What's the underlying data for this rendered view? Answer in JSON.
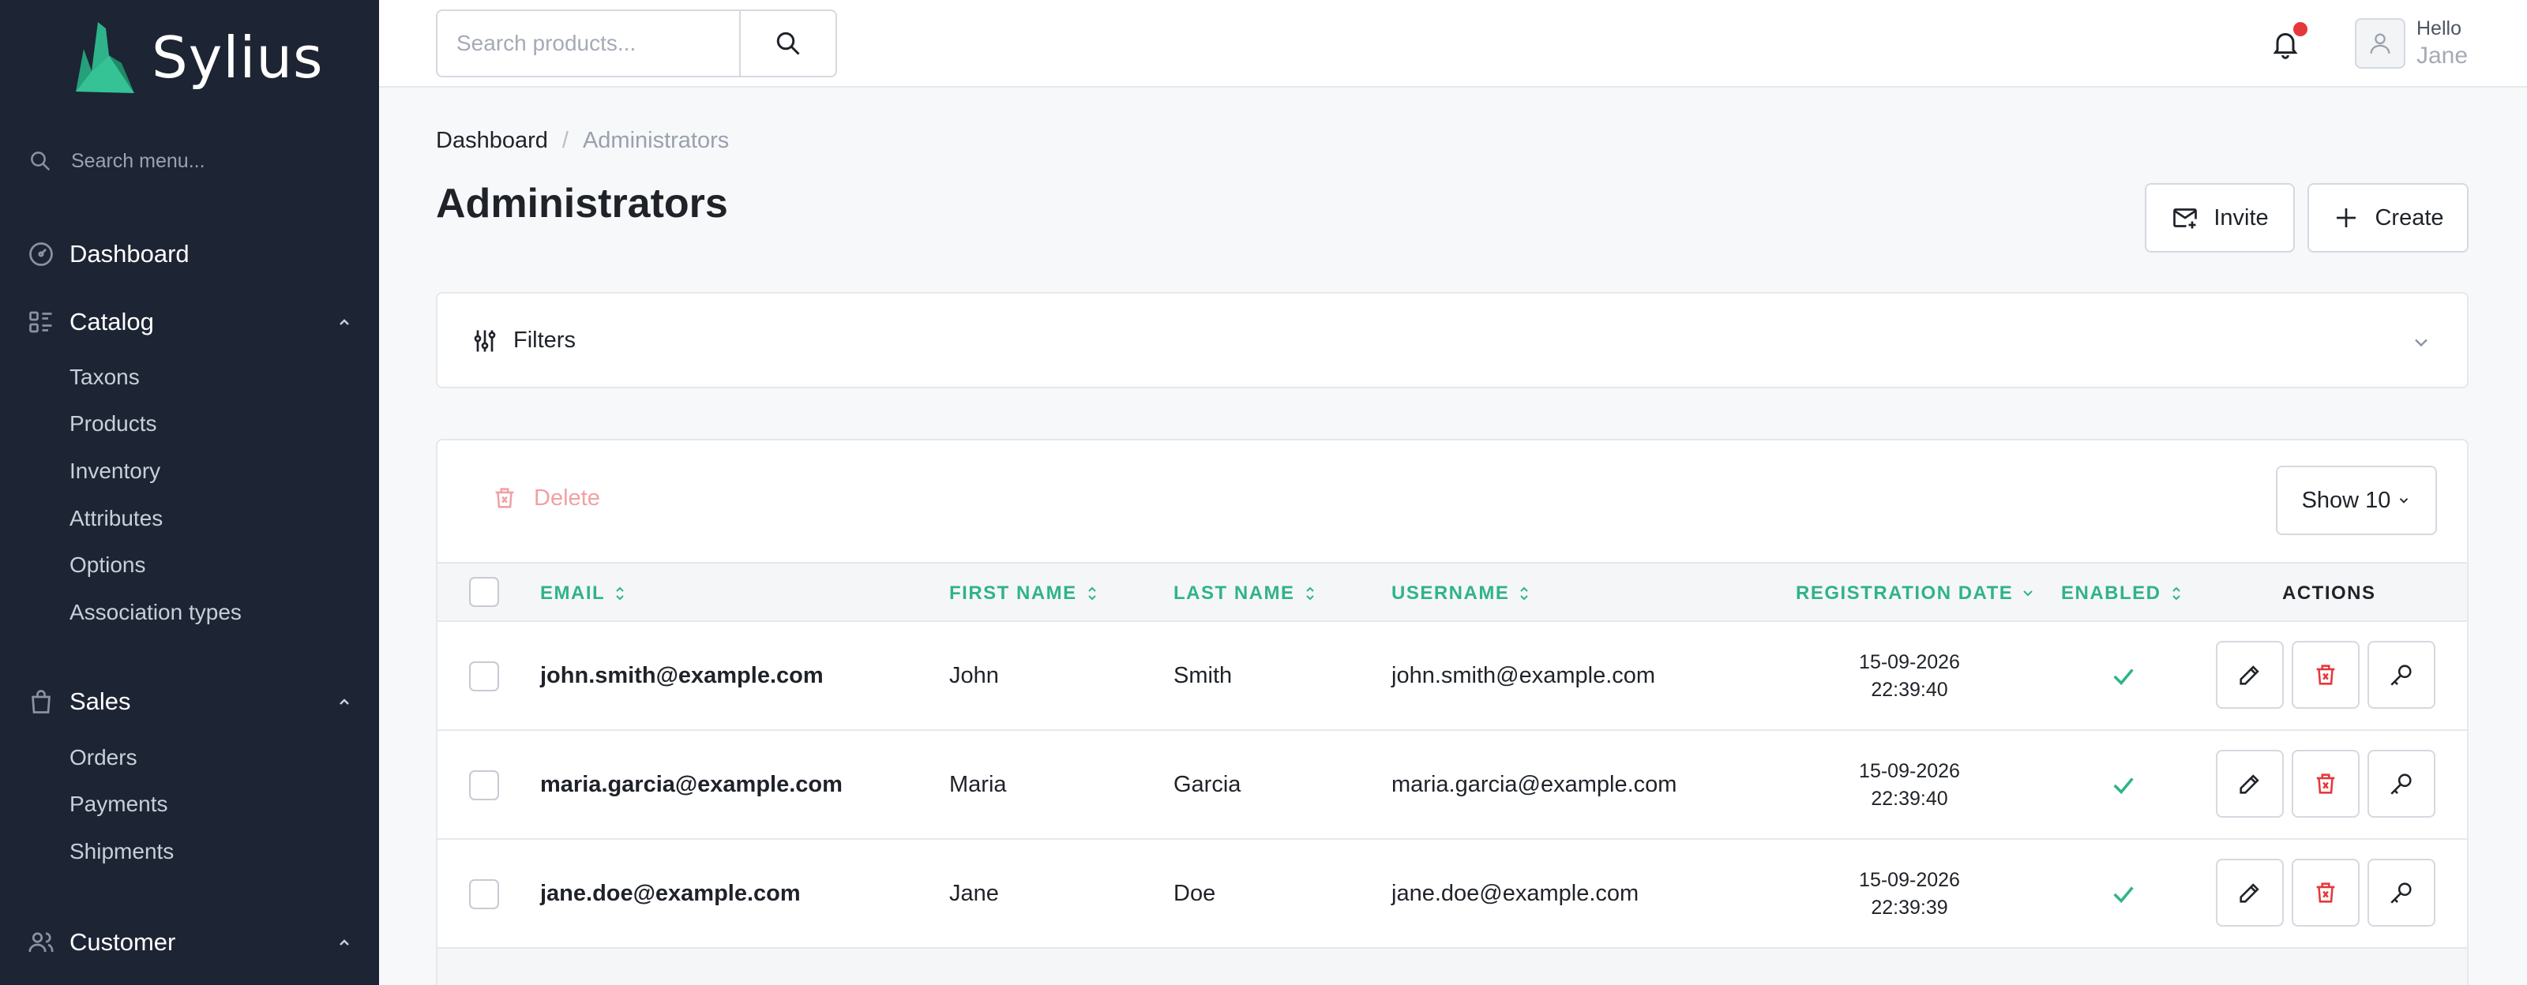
{
  "brand": {
    "name": "Sylius",
    "accent": "#2fb38a"
  },
  "sidebar": {
    "search_placeholder": "Search menu...",
    "dashboard": "Dashboard",
    "catalog": {
      "label": "Catalog",
      "items": [
        "Taxons",
        "Products",
        "Inventory",
        "Attributes",
        "Options",
        "Association types"
      ]
    },
    "sales": {
      "label": "Sales",
      "items": [
        "Orders",
        "Payments",
        "Shipments"
      ]
    },
    "customer": {
      "label": "Customer"
    }
  },
  "topbar": {
    "search_placeholder": "Search products...",
    "greeting": "Hello",
    "user_name": "Jane"
  },
  "breadcrumb": {
    "root": "Dashboard",
    "separator": "/",
    "current": "Administrators"
  },
  "page": {
    "title": "Administrators",
    "invite_label": "Invite",
    "create_label": "Create"
  },
  "filters": {
    "label": "Filters"
  },
  "table": {
    "delete_label": "Delete",
    "show_label": "Show 10",
    "columns": {
      "email": "EMAIL",
      "first_name": "FIRST NAME",
      "last_name": "LAST NAME",
      "username": "USERNAME",
      "registration_date": "REGISTRATION DATE",
      "enabled": "ENABLED",
      "actions": "ACTIONS"
    },
    "rows": [
      {
        "email": "john.smith@example.com",
        "first_name": "John",
        "last_name": "Smith",
        "username": "john.smith@example.com",
        "date": "15-09-2026",
        "time": "22:39:40",
        "enabled": true
      },
      {
        "email": "maria.garcia@example.com",
        "first_name": "Maria",
        "last_name": "Garcia",
        "username": "maria.garcia@example.com",
        "date": "15-09-2026",
        "time": "22:39:40",
        "enabled": true
      },
      {
        "email": "jane.doe@example.com",
        "first_name": "Jane",
        "last_name": "Doe",
        "username": "jane.doe@example.com",
        "date": "15-09-2026",
        "time": "22:39:39",
        "enabled": true
      }
    ]
  }
}
